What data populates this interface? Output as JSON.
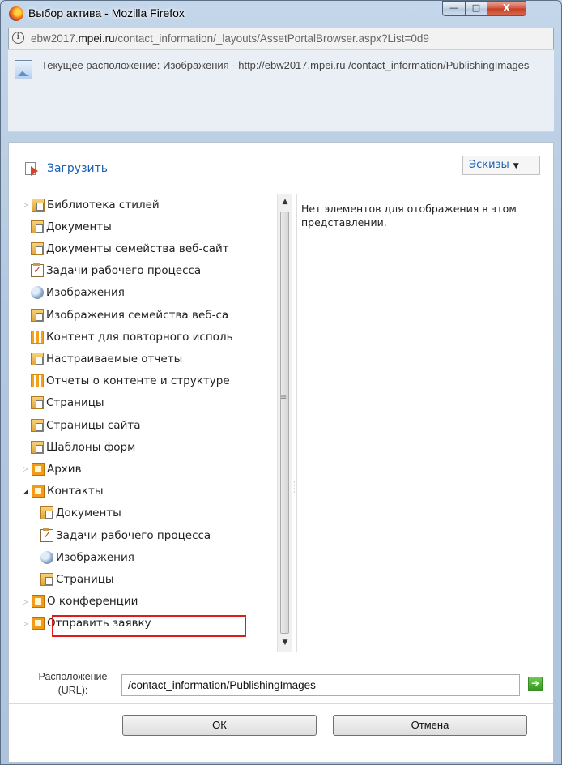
{
  "window": {
    "title": "Выбор актива - Mozilla Firefox",
    "controls": {
      "minimize": "—",
      "maximize": "□",
      "close": "X"
    }
  },
  "urlbar": {
    "prefix": "ebw2017.",
    "domain": "mpei.ru",
    "path": "/contact_information/_layouts/AssetPortalBrowser.aspx?List=0d9"
  },
  "header": {
    "current_location": "Текущее расположение: Изображения - http://ebw2017.mpei.ru /contact_information/PublishingImages"
  },
  "toolbar": {
    "upload_label": "Загрузить",
    "view_label": "Эскизы"
  },
  "tree": {
    "items": [
      {
        "label": "Библиотека стилей",
        "icon": "library-icon",
        "expander": "collapsed"
      },
      {
        "label": "Документы",
        "icon": "library-icon",
        "expander": ""
      },
      {
        "label": "Документы семейства веб-сайт",
        "icon": "library-icon",
        "expander": ""
      },
      {
        "label": "Задачи рабочего процесса",
        "icon": "task-list-icon",
        "expander": ""
      },
      {
        "label": "Изображения",
        "icon": "picture-library-icon",
        "expander": ""
      },
      {
        "label": "Изображения семейства веб-са",
        "icon": "library-icon",
        "expander": ""
      },
      {
        "label": "Контент для повторного исполь",
        "icon": "list-icon",
        "expander": ""
      },
      {
        "label": "Настраиваемые отчеты",
        "icon": "library-icon",
        "expander": ""
      },
      {
        "label": "Отчеты о контенте и структуре",
        "icon": "list-icon",
        "expander": ""
      },
      {
        "label": "Страницы",
        "icon": "library-icon",
        "expander": ""
      },
      {
        "label": "Страницы сайта",
        "icon": "library-icon",
        "expander": ""
      },
      {
        "label": "Шаблоны форм",
        "icon": "library-icon",
        "expander": ""
      },
      {
        "label": "Архив",
        "icon": "site-icon",
        "expander": "collapsed"
      },
      {
        "label": "Контакты",
        "icon": "site-icon",
        "expander": "expanded"
      },
      {
        "label": "Документы",
        "icon": "library-icon",
        "expander": ""
      },
      {
        "label": "Задачи рабочего процесса",
        "icon": "task-list-icon",
        "expander": ""
      },
      {
        "label": "Изображения",
        "icon": "picture-library-icon",
        "expander": "",
        "selected": true
      },
      {
        "label": "Страницы",
        "icon": "library-icon",
        "expander": ""
      },
      {
        "label": "О конференции",
        "icon": "site-icon",
        "expander": "collapsed"
      },
      {
        "label": "Отправить заявку",
        "icon": "site-icon",
        "expander": "collapsed"
      }
    ]
  },
  "details": {
    "empty_message": "Нет элементов для отображения в этом представлении."
  },
  "location_field": {
    "label": "Расположение (URL):",
    "value": "/contact_information/PublishingImages"
  },
  "buttons": {
    "ok": "ОК",
    "cancel": "Отмена"
  }
}
